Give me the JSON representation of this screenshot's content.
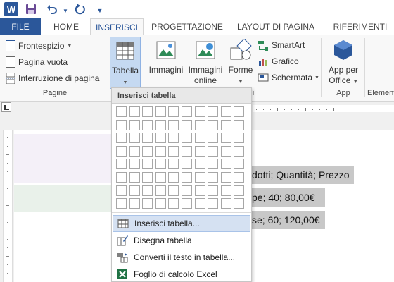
{
  "title_bar": {
    "app_icon": "W",
    "icons": [
      "word-logo-icon",
      "save-icon",
      "undo-icon",
      "redo-icon",
      "customize-dropdown-icon"
    ]
  },
  "tabs": [
    {
      "id": "file",
      "label": "FILE"
    },
    {
      "id": "home",
      "label": "HOME"
    },
    {
      "id": "insert",
      "label": "INSERISCI",
      "active": true
    },
    {
      "id": "design",
      "label": "PROGETTAZIONE"
    },
    {
      "id": "layout",
      "label": "LAYOUT DI PAGINA"
    },
    {
      "id": "refs",
      "label": "RIFERIMENTI"
    }
  ],
  "ribbon": {
    "pages_group": {
      "items": [
        "Frontespizio",
        "Pagina vuota",
        "Interruzione di pagina"
      ],
      "label": "Pagine"
    },
    "table_button": "Tabella",
    "illustrations": {
      "images": "Immagini",
      "online_images_line1": "Immagini",
      "online_images_line2": "online",
      "shapes": "Forme",
      "smartart": "SmartArt",
      "chart": "Grafico",
      "screenshot": "Schermata",
      "group_tail": "i"
    },
    "apps": {
      "app_line1": "App per",
      "app_line2": "Office",
      "label": "App"
    },
    "elements_label": "Element"
  },
  "dropdown": {
    "header": "Inserisci tabella",
    "grid": {
      "columns": 10,
      "rows": 8
    },
    "items": [
      {
        "label": "Inserisci tabella...",
        "highlighted": true,
        "icon": "table-icon"
      },
      {
        "label": "Disegna tabella",
        "highlighted": false,
        "icon": "pencil-table-icon"
      },
      {
        "label": "Converti il testo in tabella...",
        "highlighted": false,
        "icon": "convert-text-icon"
      },
      {
        "label": "Foglio di calcolo Excel",
        "highlighted": false,
        "icon": "excel-icon"
      }
    ]
  },
  "document": {
    "lines": [
      "dotti; Quantità; Prezzo",
      "pe; 40; 80,00€",
      "se; 60; 120,00€"
    ]
  },
  "colors": {
    "accent": "#2b579a",
    "selection": "#c8c8c8",
    "highlight": "#d5e1f2"
  }
}
